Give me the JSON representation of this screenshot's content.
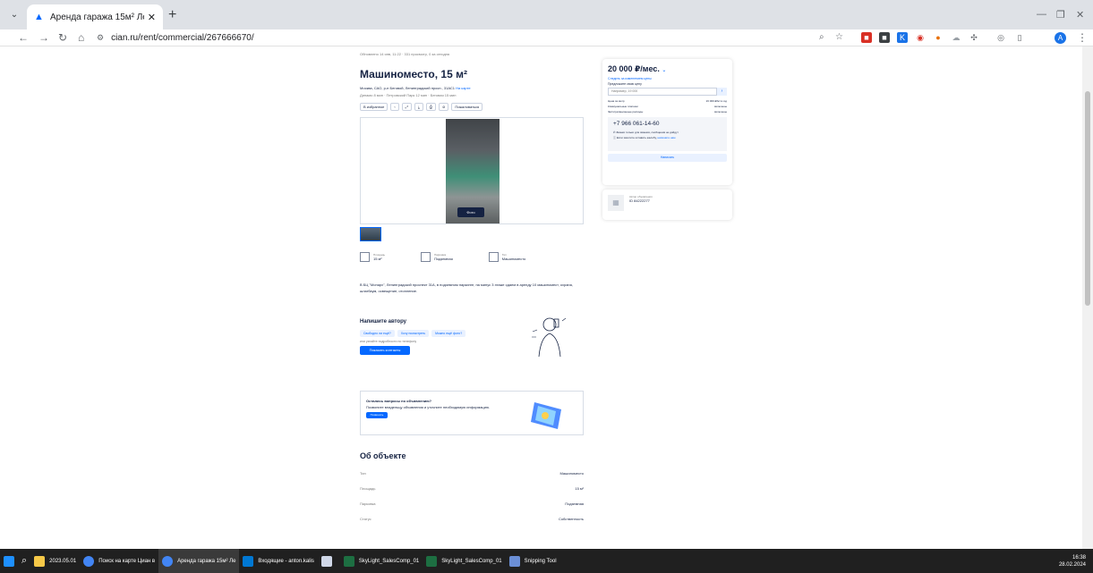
{
  "browser": {
    "tab_title": "Аренда гаража 15м² Ленингр",
    "tab_close": "✕",
    "new_tab": "+",
    "url": "cian.ru/rent/commercial/267666670/",
    "profile_initial": "A"
  },
  "listing": {
    "meta": "Обновлено 14 янв, 11:22 · 331 просмотр, 0 за сегодня",
    "title": "Машиноместо, 15 м²",
    "address": "Москва, САО, р-н Беговой, Ленинградский просп., 31АС1",
    "map_link": "На карте",
    "metros": "Динамо 8 мин · Петровский Парк 12 мин · Беговая 15 мин",
    "actions": [
      "В избранное",
      "‹",
      "⤢",
      "⤓",
      "⎙",
      "⊘",
      "Пожаловаться"
    ],
    "photo_button": "Фото",
    "facts": [
      {
        "label": "Площадь",
        "value": "15 м²"
      },
      {
        "label": "Парковка",
        "value": "Подземная"
      },
      {
        "label": "Тип",
        "value": "Машиноместо"
      }
    ],
    "description": "В БЦ \"Монарх\", Ленинградский проспект 31А, в подземном паркинге, на минус 3 этаже сдаем в аренду 10 машиномест, охрана, шлагбаум, освещение, отопление."
  },
  "write_author": {
    "title": "Напишите автору",
    "chips": [
      "Свободно ли ещё?",
      "Хочу посмотреть",
      "Можно ещё фото?"
    ],
    "call_hint": "или узнайте подробности по телефону",
    "contacts_button": "Показать контакты"
  },
  "questions": {
    "title": "Остались вопросы по объявлению?",
    "text": "Позвоните владельцу объявления и уточните необходимую информацию.",
    "button": "Позвонить"
  },
  "about": {
    "title": "Об объекте",
    "rows": [
      {
        "k": "Тип",
        "v": "Машиноместо"
      },
      {
        "k": "Площадь",
        "v": "15 м²"
      },
      {
        "k": "Парковка",
        "v": "Подземная"
      },
      {
        "k": "Статус",
        "v": "Собственность"
      }
    ]
  },
  "price_card": {
    "price": "20 000 ₽/мес.",
    "watch": "Следить за изменением цены",
    "suggest": "Предложите свою цену",
    "input_placeholder": "Например, 19 000",
    "go": "›",
    "conditions": [
      {
        "k": "Цена за метр",
        "v": "16 000 ₽/м² в год"
      },
      {
        "k": "Коммунальные платежи",
        "v": "включены"
      },
      {
        "k": "Эксплуатационные расходы",
        "v": "включены"
      }
    ],
    "phone": "+7 966 061-14-60",
    "hint1": "Звонки только для звонков, сообщения не дойдут",
    "hint2": "Если захотите оставить жалобу, ",
    "hint2_link": "напишите нам",
    "write_button": "Написать"
  },
  "author": {
    "role": "Автор объявления",
    "id": "ID 84222277"
  },
  "taskbar": {
    "items": [
      "2023.05.01",
      "Поиск на карте Циан в",
      "Аренда гаража 15м² Ле",
      "Входящие - anton.kalis",
      "",
      "SkyLight_SalesComp_01",
      "SkyLight_SalesComp_01",
      "Snipping Tool"
    ],
    "time": "16:38",
    "date": "28.02.2024"
  },
  "colors": {
    "accent": "#0468ff",
    "text": "#152242",
    "taskbar": "#202020"
  }
}
